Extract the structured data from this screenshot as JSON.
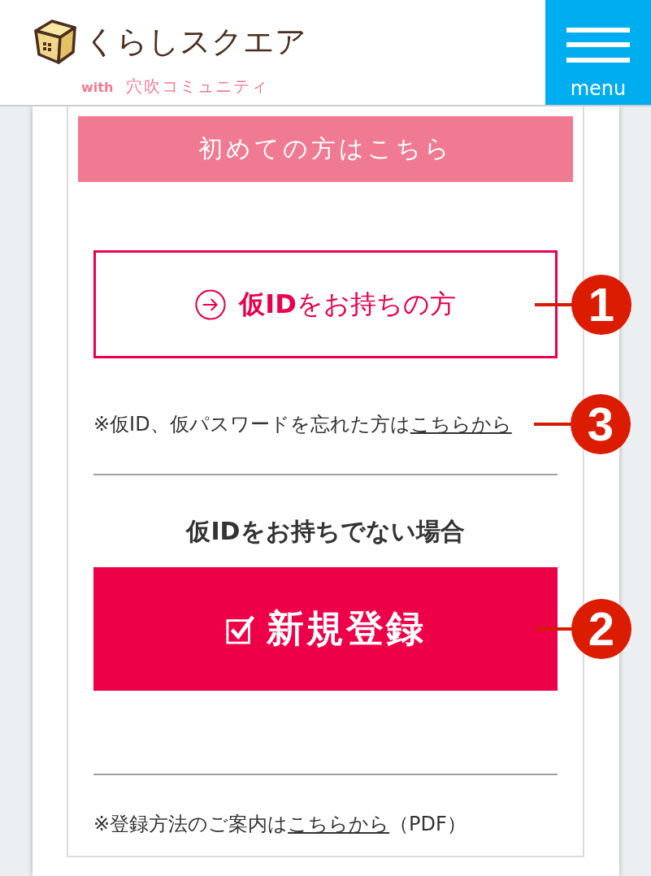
{
  "header": {
    "logo_text": "くらしスクエア",
    "tagline_prefix": "with",
    "tagline": "穴吹コミュニティ",
    "menu_label": "menu"
  },
  "banner": "初めての方はこちら",
  "login_button": {
    "label": "**仮ID**をお持ちの方",
    "callout": "1"
  },
  "forgot_note": {
    "text": "※仮ID、仮パスワードを忘れた方は",
    "link": "こちらから",
    "callout": "3"
  },
  "register_heading": "仮IDをお持ちでない場合",
  "register_button": {
    "label": "新規登録",
    "callout": "2"
  },
  "guide_note": {
    "text": "※登録方法のご案内は",
    "link": "こちらから",
    "suffix": "（PDF）"
  }
}
